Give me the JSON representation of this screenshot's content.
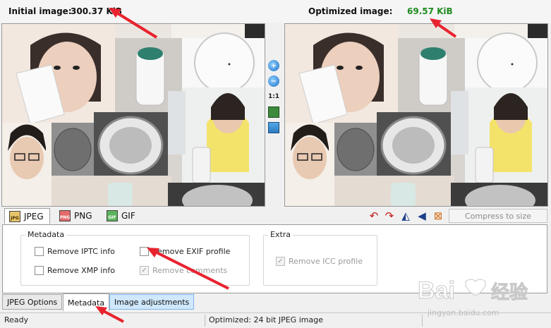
{
  "header": {
    "initial_label": "Initial image:",
    "initial_size": "300.37 KiB",
    "optimized_label": "Optimized image:",
    "optimized_size": "69.57 KiB",
    "optimized_color": "#1e8a1e"
  },
  "viewer_tools": {
    "zoom_in": "zoom-in-icon",
    "zoom_out": "zoom-out-icon",
    "actual_size": "1:1",
    "fit": "picture-icon",
    "compare": "compare-icon"
  },
  "format_tabs": [
    {
      "label": "JPEG",
      "icon_text": "JPG"
    },
    {
      "label": "PNG",
      "icon_text": "PNG"
    },
    {
      "label": "GIF",
      "icon_text": "GIF"
    }
  ],
  "toolbar": {
    "compress_label": "Compress to size",
    "icon_color": "#c21818"
  },
  "metadata": {
    "title": "Metadata",
    "options": [
      {
        "label": "Remove IPTC info",
        "checked": false,
        "disabled": false
      },
      {
        "label": "Remove EXIF profile",
        "checked": false,
        "disabled": false
      },
      {
        "label": "Remove XMP info",
        "checked": false,
        "disabled": false
      },
      {
        "label": "Remove comments",
        "checked": true,
        "disabled": true
      }
    ]
  },
  "extra": {
    "title": "Extra",
    "options": [
      {
        "label": "Remove ICC profile",
        "checked": true,
        "disabled": true
      }
    ]
  },
  "bottom_tabs": [
    "JPEG Options",
    "Metadata",
    "Image adjustments"
  ],
  "status": {
    "left": "Ready",
    "right": "Optimized: 24 bit JPEG image"
  },
  "colors": {
    "arrow": "#e8232e",
    "panel_border": "#9a9a9a",
    "tab_highlight": "#cfe8fb"
  },
  "watermark": {
    "brand": "Bai",
    "brand_cn": "经验",
    "url": "jingyan.baidu.com"
  }
}
